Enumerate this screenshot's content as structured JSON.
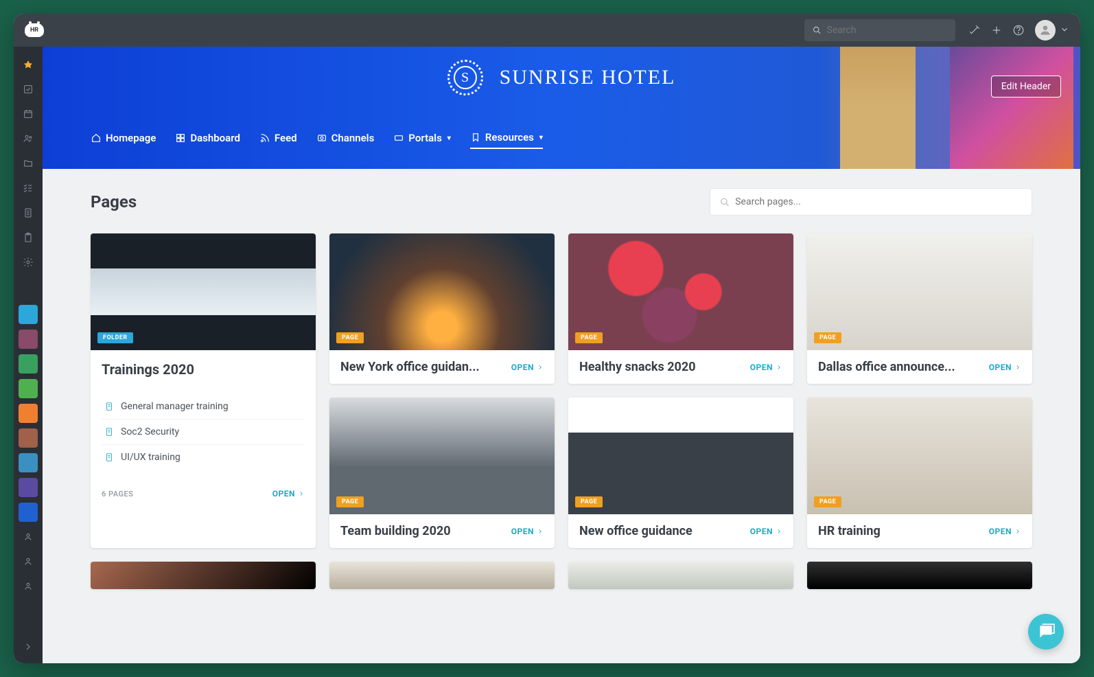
{
  "topbar": {
    "hr_badge": "HR",
    "search_placeholder": "Search"
  },
  "hero": {
    "emblem_letter": "S",
    "title": "SUNRISE HOTEL",
    "edit_button": "Edit Header"
  },
  "nav": {
    "items": [
      {
        "label": "Homepage",
        "icon": "home",
        "dropdown": false,
        "active": false
      },
      {
        "label": "Dashboard",
        "icon": "grid",
        "dropdown": false,
        "active": false
      },
      {
        "label": "Feed",
        "icon": "wifi",
        "dropdown": false,
        "active": false
      },
      {
        "label": "Channels",
        "icon": "camera",
        "dropdown": false,
        "active": false
      },
      {
        "label": "Portals",
        "icon": "card",
        "dropdown": true,
        "active": false
      },
      {
        "label": "Resources",
        "icon": "bookmark",
        "dropdown": true,
        "active": true
      }
    ]
  },
  "content": {
    "title": "Pages",
    "search_placeholder": "Search pages...",
    "open_label": "OPEN",
    "folder_badge": "FOLDER",
    "page_badge": "PAGE",
    "cards": [
      {
        "type": "folder",
        "title": "Trainings 2020",
        "files": [
          "General manager training",
          "Soc2 Security",
          "UI/UX training"
        ],
        "page_count": "6 PAGES",
        "img": "img-1"
      },
      {
        "type": "page",
        "title": "New York office guidan...",
        "img": "img-2"
      },
      {
        "type": "page",
        "title": "Healthy snacks 2020",
        "img": "img-3"
      },
      {
        "type": "page",
        "title": "Dallas office announce...",
        "img": "img-4"
      },
      {
        "type": "page",
        "title": "Team building 2020",
        "img": "img-5"
      },
      {
        "type": "page",
        "title": "New office guidance",
        "img": "img-6"
      },
      {
        "type": "page",
        "title": "HR training",
        "img": "img-7"
      },
      {
        "type": "partial",
        "img": "img-8"
      },
      {
        "type": "partial",
        "img": "img-9"
      },
      {
        "type": "partial",
        "img": "img-10"
      },
      {
        "type": "partial",
        "img": "img-11"
      }
    ]
  }
}
